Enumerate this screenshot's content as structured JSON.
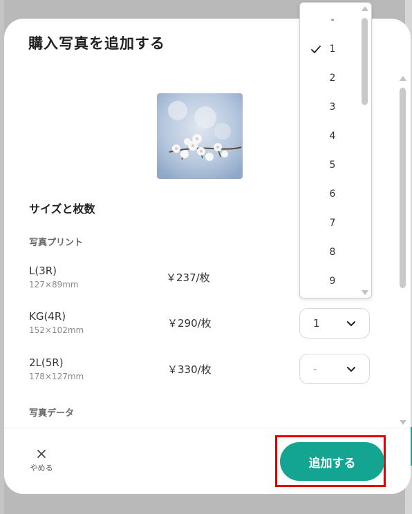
{
  "dialog": {
    "title": "購入写真を追加する",
    "section_title": "サイズと枚数",
    "print_section": "写真プリント",
    "data_section": "写真データ",
    "photo_alt": "桜の写真"
  },
  "items": [
    {
      "name": "L(3R)",
      "dimensions": "127×89mm",
      "price": "￥237/枚",
      "quantity": ""
    },
    {
      "name": "KG(4R)",
      "dimensions": "152×102mm",
      "price": "￥290/枚",
      "quantity": "1"
    },
    {
      "name": "2L(5R)",
      "dimensions": "178×127mm",
      "price": "￥330/枚",
      "quantity": "-"
    }
  ],
  "dropdown": {
    "options": [
      "-",
      "1",
      "2",
      "3",
      "4",
      "5",
      "6",
      "7",
      "8",
      "9"
    ],
    "selected": "1"
  },
  "footer": {
    "cancel_label": "やめる",
    "add_label": "追加する"
  },
  "colors": {
    "accent": "#14a592",
    "highlight": "#e00000"
  }
}
